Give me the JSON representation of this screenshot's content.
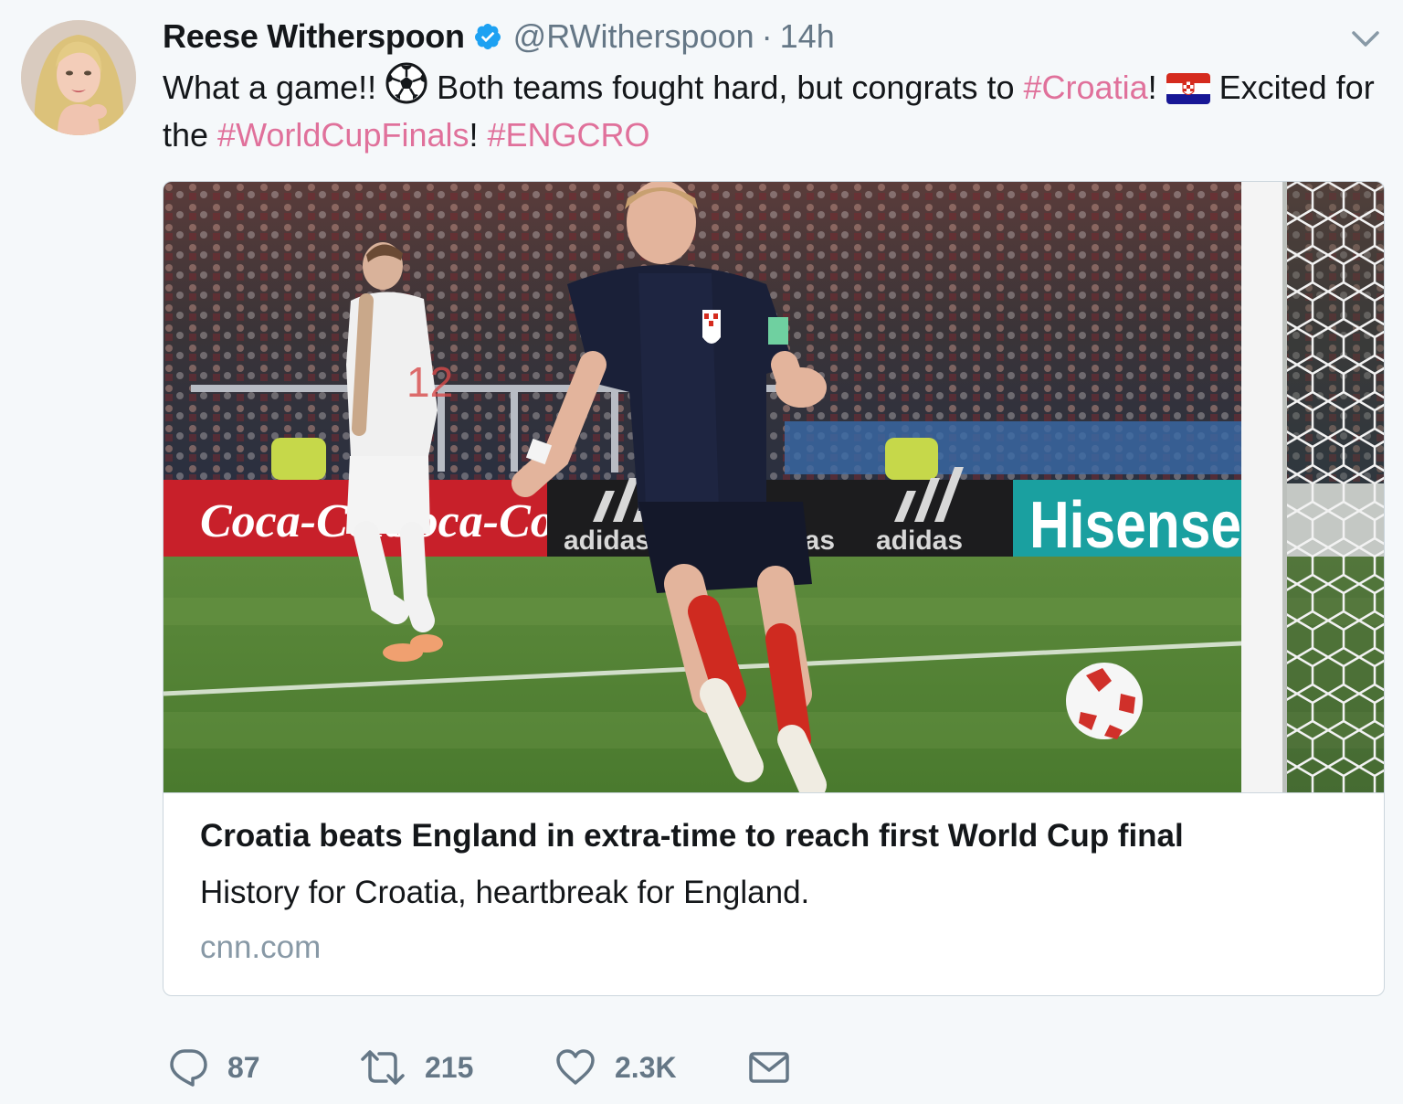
{
  "tweet": {
    "author": {
      "display_name": "Reese Witherspoon",
      "handle": "@RWitherspoon",
      "verified": true
    },
    "separator": "·",
    "timestamp": "14h",
    "text": {
      "part1": "What a game!! ",
      "part2": " Both teams fought hard, but congrats to ",
      "hashtag_croatia": "#Croatia",
      "part3": "! ",
      "part4": " Excited for the ",
      "hashtag_worldcup": "#WorldCupFinals",
      "part5": "! ",
      "hashtag_engcro": "#ENGCRO"
    },
    "colors": {
      "hashtag": "#e0719b",
      "muted": "#657786",
      "verified": "#1da1f2"
    }
  },
  "card": {
    "title": "Croatia beats England in extra-time to reach first World Cup final",
    "description": "History for Croatia, heartbreak for England.",
    "domain": "cnn.com",
    "image_ad_texts": {
      "coca_cola_1": "Coca-Cola",
      "coca_cola_2": "Coca-Cola",
      "adidas_1": "adidas",
      "adidas_2": "adidas",
      "adidas_3": "adidas",
      "hisense": "Hisense"
    }
  },
  "actions": {
    "reply": {
      "icon": "reply-icon",
      "count": "87"
    },
    "retweet": {
      "icon": "retweet-icon",
      "count": "215"
    },
    "like": {
      "icon": "heart-icon",
      "count": "2.3K"
    },
    "message": {
      "icon": "envelope-icon"
    }
  }
}
